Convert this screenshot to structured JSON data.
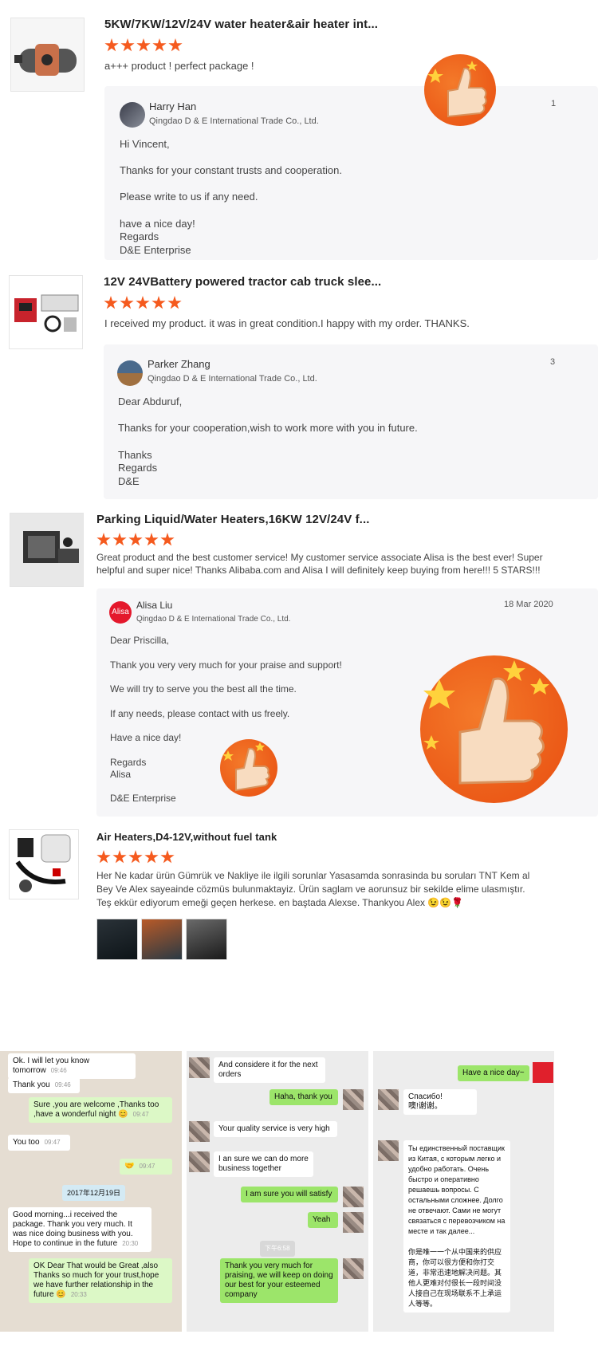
{
  "reviews": [
    {
      "product_title": "5KW/7KW/12V/24V water heater&air heater int...",
      "rating": 5,
      "review_text": "a+++ product ! perfect package !",
      "reply": {
        "name": "Harry Han",
        "company": "Qingdao D & E International Trade Co., Ltd.",
        "date_partial": "1",
        "lines": [
          "Hi Vincent,",
          "Thanks for your constant trusts and cooperation.",
          "Please write to us if any need.",
          "have a nice day!",
          "Regards",
          "D&E Enterprise"
        ]
      }
    },
    {
      "product_title": "12V 24VBattery powered tractor cab truck slee...",
      "rating": 5,
      "review_text": "I received my product. it was in great condition.I happy with my order. THANKS.",
      "reply": {
        "name": "Parker Zhang",
        "company": "Qingdao D & E International Trade Co., Ltd.",
        "date_partial": "3",
        "lines": [
          "Dear Abduruf,",
          "Thanks for your cooperation,wish to work more with you in future.",
          "Thanks",
          "Regards",
          "D&E"
        ]
      }
    },
    {
      "product_title": "Parking Liquid/Water Heaters,16KW 12V/24V f...",
      "rating": 5,
      "review_text": "Great product and the best customer service!  My customer service associate Alisa is the best ever!  Super helpful and super nice!  Thanks Alibaba.com and Alisa I will definitely keep buying from here!!!   5 STARS!!!",
      "reply": {
        "name": "Alisa Liu",
        "avatar_text": "Alisa",
        "company": "Qingdao D & E International Trade Co., Ltd.",
        "date": "18 Mar 2020",
        "lines": [
          "Dear Priscilla,",
          "Thank you very very much for your praise and support!",
          "We will try to serve you the best all the time.",
          "If any needs, please contact with us freely.",
          "Have a nice day!",
          "Regards",
          "Alisa",
          "D&E Enterprise"
        ]
      }
    },
    {
      "product_title": "Air Heaters,D4-12V,without fuel tank",
      "rating": 5,
      "review_text": "Her Ne kadar ürün Gümrük ve Nakliye ile ilgili sorunlar Yasasamda sonrasinda bu soruları TNT Kem al Bey Ve Alex sayeainde cözmüs bulunmaktayiz. Ürün saglam ve aorunsuz bir sekilde elime ulasmıştır. Teş ekkür ediyorum emeği geçen herkese. en baştada Alexse. Thankyou Alex 😉😉🌹"
    }
  ],
  "chat1": [
    {
      "text": "Ok. I will let you know tomorrow",
      "time": "09:46"
    },
    {
      "text": "Thank you",
      "time": "09:46"
    },
    {
      "text": "Sure ,you are welcome ,Thanks too ,have a wonderful night 😊",
      "time": "09:47"
    },
    {
      "text": "You too",
      "time": "09:47"
    },
    {
      "text": "🤝",
      "time": "09:47"
    },
    {
      "text": "2017年12月19日"
    },
    {
      "text": "Good morning...i received the package.  Thank you very much. It was nice doing business with you. Hope to continue in the future",
      "time": "20:30"
    },
    {
      "text": "OK Dear That would be Great ,also Thanks so much for your trust,hope we have further relationship in the future 😊",
      "time": "20:33"
    }
  ],
  "chat2": [
    "And considere it for the next orders",
    "Haha, thank you",
    "Your quality service is very high",
    "I an sure we can do more business together",
    "I am sure you will satisfy",
    "Yeah",
    "下午6:58",
    "Thank you very much for praising, we will keep on doing our best for your esteemed company"
  ],
  "chat3": [
    "Have a nice day~",
    "Спасибо!",
    "噢!谢谢。",
    "Ты единственный поставщик из Китая, с которым легко и удобно работать. Очень быстро и оперативно решаешь вопросы. С остальными сложнее. Долго не отвечают. Сами не могут связаться с перевозчиком на месте и так далее...",
    "你是唯一一个从中国来的供应商，你可以很方便和你打交道，非常迅速地解决问题。其他人更难对付很长一段时间没人接自己在现场联系不上承运人等等。"
  ],
  "colors": {
    "accent": "#f55a1e",
    "reply_bg": "#f6f6f8",
    "whatsapp_green": "#dcf8c6",
    "wechat_green": "#9ce56a"
  }
}
